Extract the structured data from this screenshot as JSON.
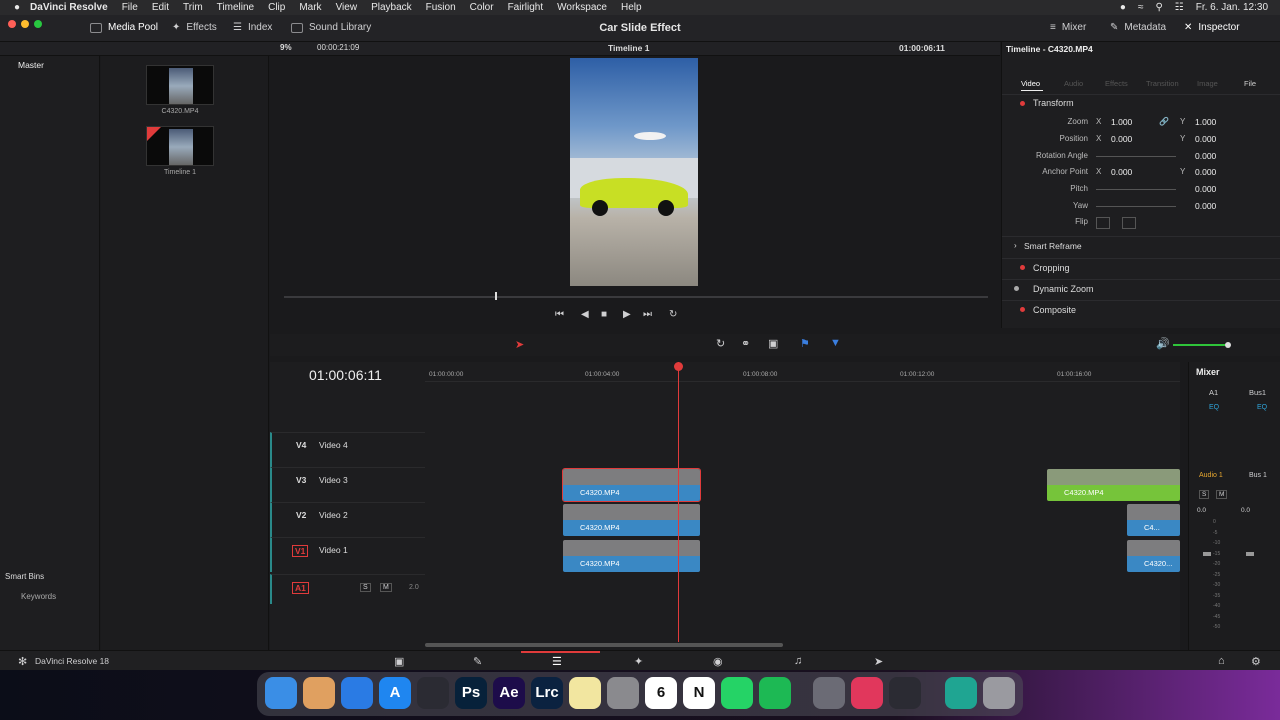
{
  "menubar": {
    "app": "DaVinci Resolve",
    "items": [
      "File",
      "Edit",
      "Trim",
      "Timeline",
      "Clip",
      "Mark",
      "View",
      "Playback",
      "Fusion",
      "Color",
      "Fairlight",
      "Workspace",
      "Help"
    ],
    "clock": "Fr. 6. Jan.  12:30"
  },
  "toolbar": {
    "media_pool": "Media Pool",
    "effects": "Effects",
    "index": "Index",
    "sound_library": "Sound Library",
    "project_title": "Car Slide Effect",
    "mixer": "Mixer",
    "metadata": "Metadata",
    "inspector": "Inspector"
  },
  "mediapool": {
    "zoom": "9%",
    "timecode": "00:00:21:09",
    "master": "Master",
    "items": [
      {
        "label": "C4320.MP4"
      },
      {
        "label": "Timeline 1"
      }
    ],
    "smart_bins": "Smart Bins",
    "keywords": "Keywords"
  },
  "viewer": {
    "timeline_name": "Timeline 1",
    "timecode": "01:00:06:11"
  },
  "inspector": {
    "title": "Timeline - C4320.MP4",
    "tabs": [
      "Video",
      "Audio",
      "Effects",
      "Transition",
      "Image",
      "File"
    ],
    "transform": "Transform",
    "zoom_label": "Zoom",
    "zoom_x": "1.000",
    "zoom_y": "1.000",
    "position_label": "Position",
    "position_x": "0.000",
    "position_y": "0.000",
    "rotation_label": "Rotation Angle",
    "rotation": "0.000",
    "anchor_label": "Anchor Point",
    "anchor_x": "0.000",
    "anchor_y": "0.000",
    "pitch_label": "Pitch",
    "pitch": "0.000",
    "yaw_label": "Yaw",
    "yaw": "0.000",
    "flip_label": "Flip",
    "x": "X",
    "y": "Y",
    "smart_reframe": "Smart Reframe",
    "cropping": "Cropping",
    "dynamic_zoom": "Dynamic Zoom",
    "composite": "Composite"
  },
  "timeline": {
    "timecode": "01:00:06:11",
    "ruler": [
      "01:00:00:00",
      "01:00:04:00",
      "01:00:08:00",
      "01:00:12:00",
      "01:00:16:00"
    ],
    "tracks": [
      {
        "id": "V4",
        "name": "Video 4"
      },
      {
        "id": "V3",
        "name": "Video 3"
      },
      {
        "id": "V2",
        "name": "Video 2"
      },
      {
        "id": "V1",
        "name": "Video 1"
      }
    ],
    "audio_track": {
      "id": "A1",
      "s": "S",
      "m": "M",
      "level": "2.0"
    },
    "clip_label": "C4320.MP4",
    "clip_short1": "C4...",
    "clip_short2": "C4320..."
  },
  "mixer": {
    "title": "Mixer",
    "ch1": "A1",
    "ch2": "Bus1",
    "eq": "EQ",
    "audio1": "Audio 1",
    "bus1": "Bus 1",
    "s": "S",
    "m": "M",
    "zero": "0.0",
    "scale": [
      "0",
      "-5",
      "-10",
      "-15",
      "-20",
      "-25",
      "-30",
      "-35",
      "-40",
      "-45",
      "-50"
    ]
  },
  "bottom": {
    "app_name": "DaVinci Resolve 18"
  },
  "dock": {
    "icons": [
      {
        "name": "finder",
        "color": "#3a8ee6",
        "text": ""
      },
      {
        "name": "launchpad",
        "color": "#e0a060",
        "text": ""
      },
      {
        "name": "safari",
        "color": "#2a7be4",
        "text": ""
      },
      {
        "name": "app-store",
        "color": "#1f86f0",
        "text": "A"
      },
      {
        "name": "davinci",
        "color": "#2b2b33",
        "text": ""
      },
      {
        "name": "photoshop",
        "color": "#07213a",
        "text": "Ps"
      },
      {
        "name": "after-effects",
        "color": "#1d0c4a",
        "text": "Ae"
      },
      {
        "name": "lightroom",
        "color": "#0b2240",
        "text": "Lrc"
      },
      {
        "name": "notes",
        "color": "#f2e6a0",
        "text": ""
      },
      {
        "name": "system-settings",
        "color": "#8a8a8e",
        "text": ""
      },
      {
        "name": "calendar",
        "color": "#ffffff",
        "text": "6"
      },
      {
        "name": "notion",
        "color": "#ffffff",
        "text": "N"
      },
      {
        "name": "whatsapp",
        "color": "#25d366",
        "text": ""
      },
      {
        "name": "spotify",
        "color": "#1db954",
        "text": ""
      },
      {
        "name": "quicktime",
        "color": "#6b6b75",
        "text": ""
      },
      {
        "name": "creative-cloud",
        "color": "#e1375c",
        "text": ""
      },
      {
        "name": "davinci-2",
        "color": "#2b2b33",
        "text": ""
      },
      {
        "name": "chatgpt",
        "color": "#1fa592",
        "text": ""
      },
      {
        "name": "trash",
        "color": "#9a9aa0",
        "text": ""
      }
    ]
  },
  "colors": {
    "accent_red": "#e03b3b",
    "clip_blue": "#3a88c4",
    "clip_green": "#76c43a",
    "playhead": "#e03b3b"
  }
}
